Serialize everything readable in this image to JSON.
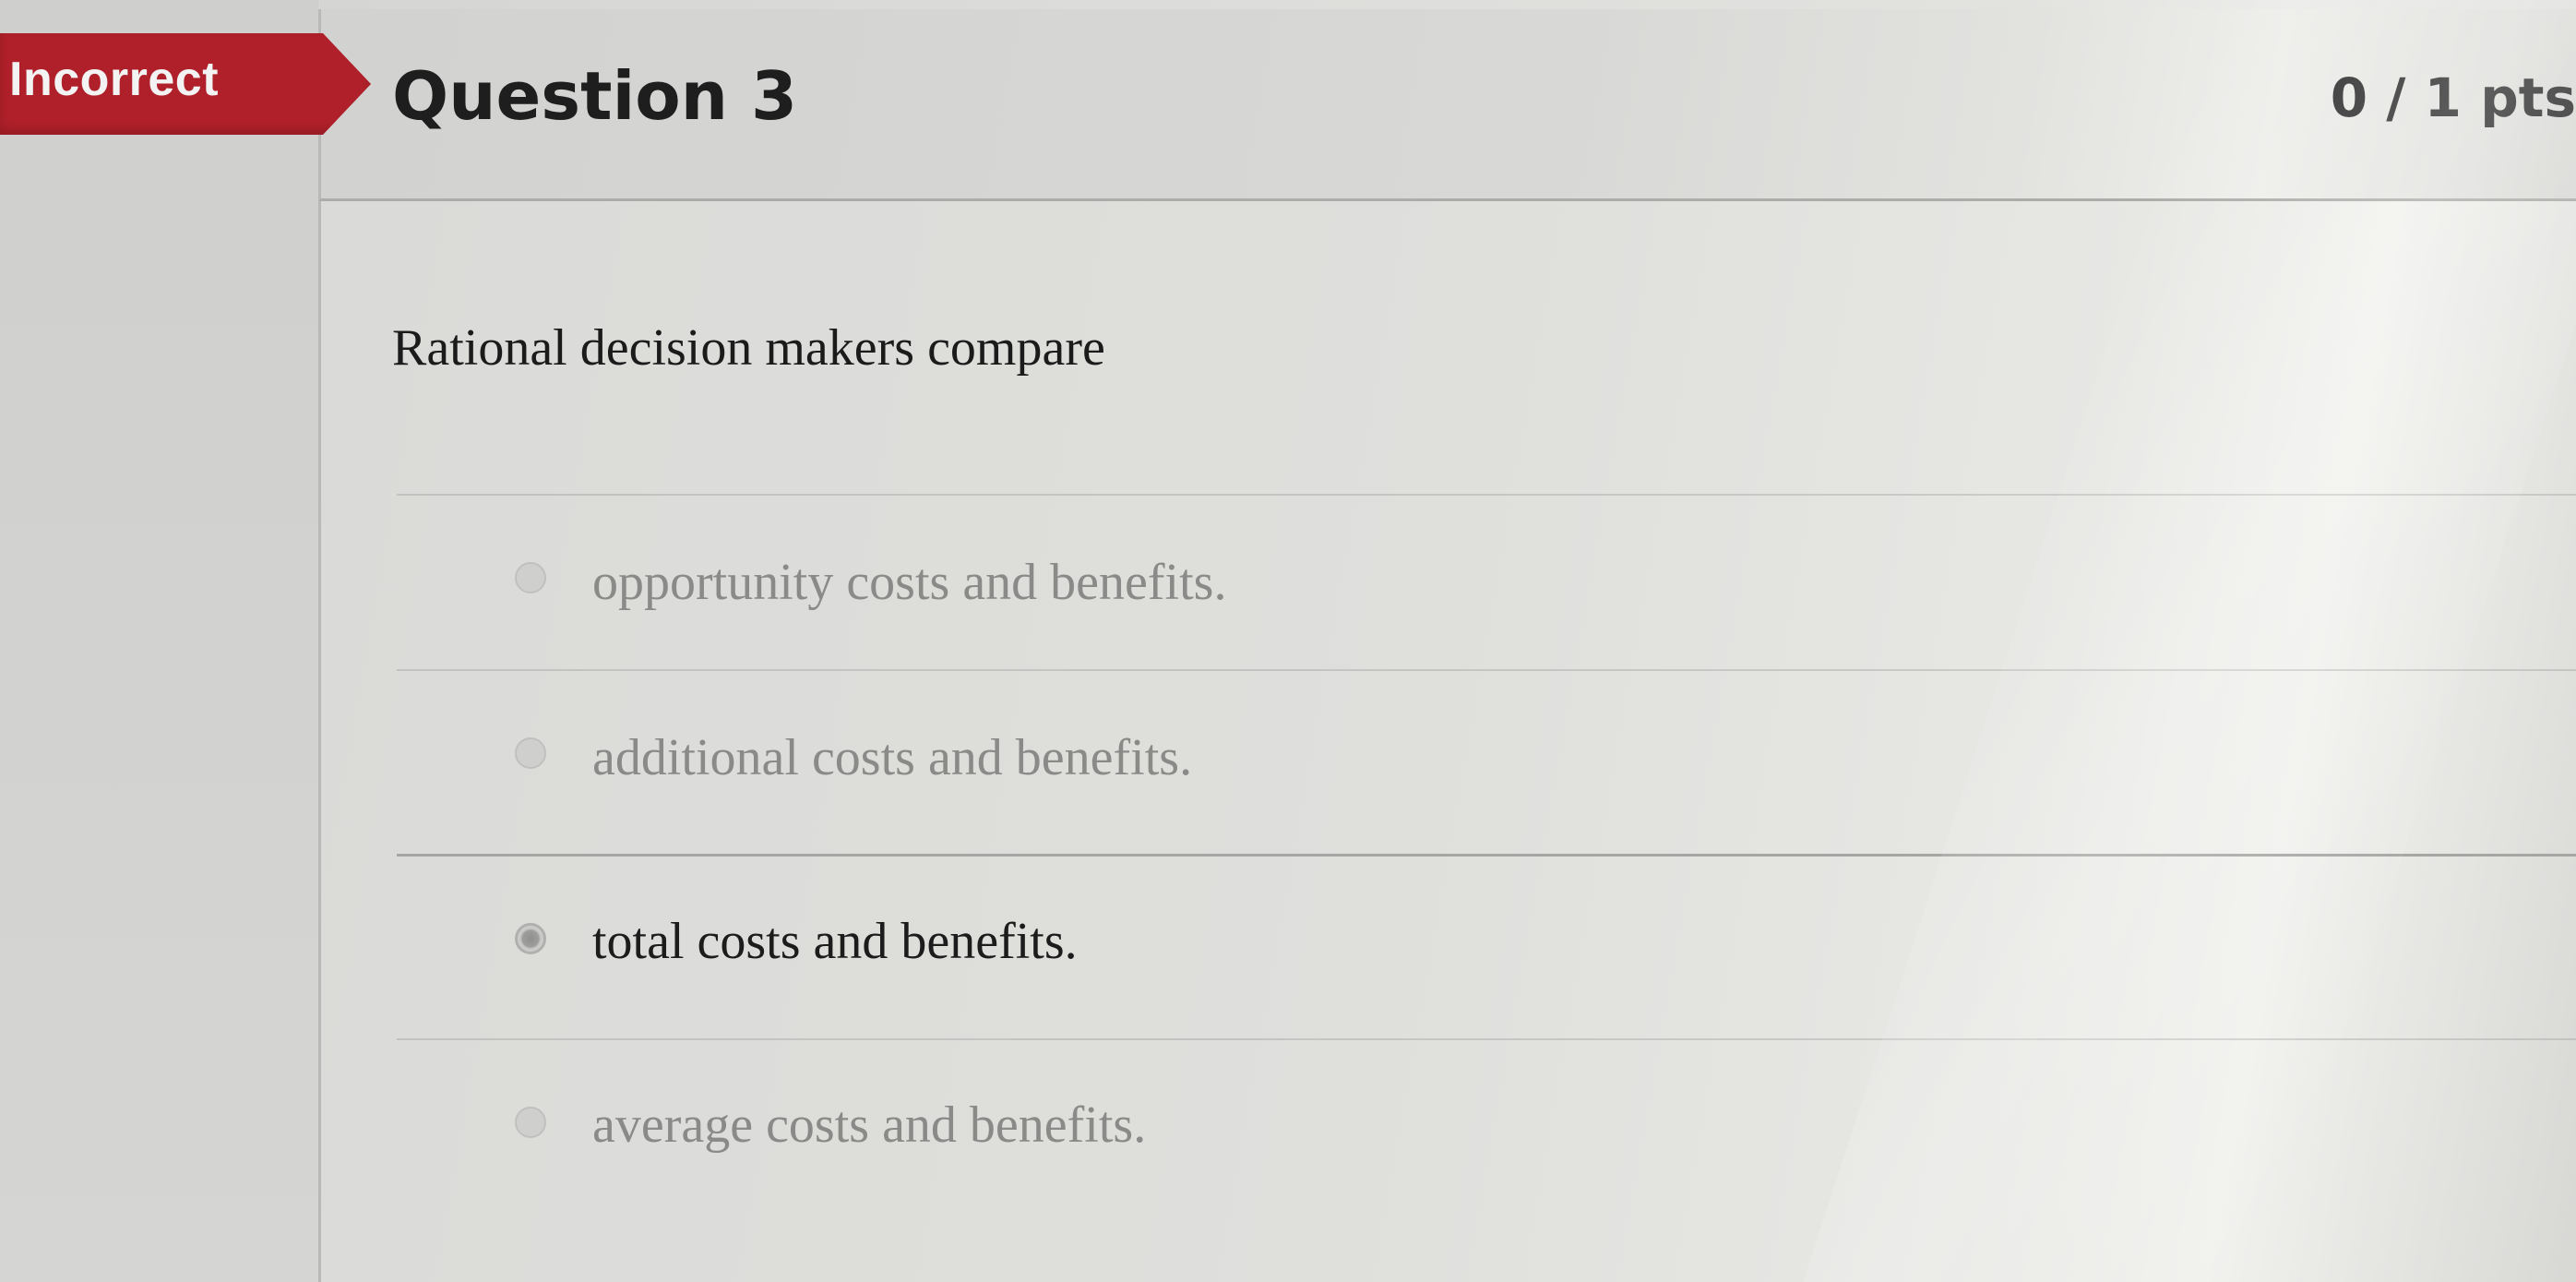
{
  "status": {
    "label": "Incorrect",
    "color": "#b0202a"
  },
  "question": {
    "title": "Question 3",
    "points": "0 / 1 pts",
    "prompt": "Rational decision makers compare",
    "answers": [
      {
        "label": "opportunity costs and benefits.",
        "selected": false
      },
      {
        "label": "additional costs and benefits.",
        "selected": false
      },
      {
        "label": "total costs and benefits.",
        "selected": true
      },
      {
        "label": "average costs and benefits.",
        "selected": false
      }
    ]
  }
}
